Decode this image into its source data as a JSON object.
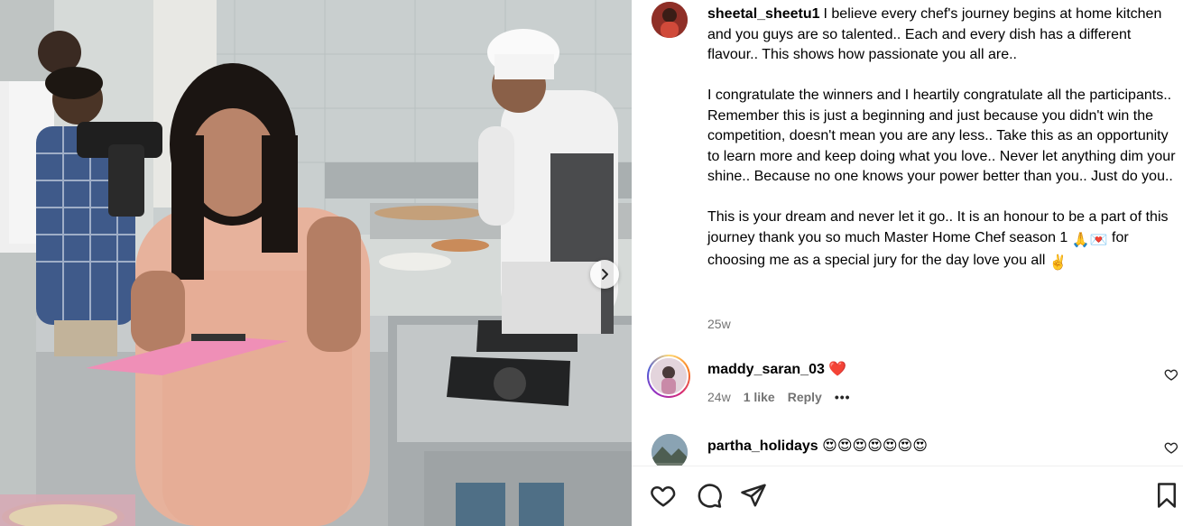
{
  "post": {
    "author": "sheetal_sheetu1",
    "caption_lines": [
      "I believe every chef's journey begins at home kitchen and you guys are so talented.. Each and every dish has a different flavour.. This shows how passionate you all are..",
      "I congratulate the winners and I heartily congratulate all the participants.. Remember this is just a beginning and just because you didn't win the competition, doesn't mean you are any less.. Take this as an opportunity to learn more and keep doing what you love.. Never let anything dim your shine.. Because no one knows your power better than you.. Just do you.."
    ],
    "caption_last_before": "This is your dream and never let it go.. It is an honour to be a part of this journey thank you so much Master Home Chef season 1 ",
    "caption_last_mid": " for choosing me as a special jury for the day love you all ",
    "time": "25w"
  },
  "comments": [
    {
      "username": "maddy_saran_03",
      "text": "❤️",
      "time": "24w",
      "likes": "1 like",
      "reply": "Reply",
      "more": "•••"
    },
    {
      "username": "partha_holidays",
      "text": "😍😍😍😍😍😍😍"
    }
  ],
  "icons": {
    "carousel": "chevron-right-icon",
    "like": "heart-outline-icon",
    "comment": "comment-bubble-icon",
    "share": "paper-plane-icon",
    "save": "bookmark-icon"
  },
  "colors": {
    "muted": "#737373",
    "heart": "#ed4956",
    "text": "#000000"
  }
}
